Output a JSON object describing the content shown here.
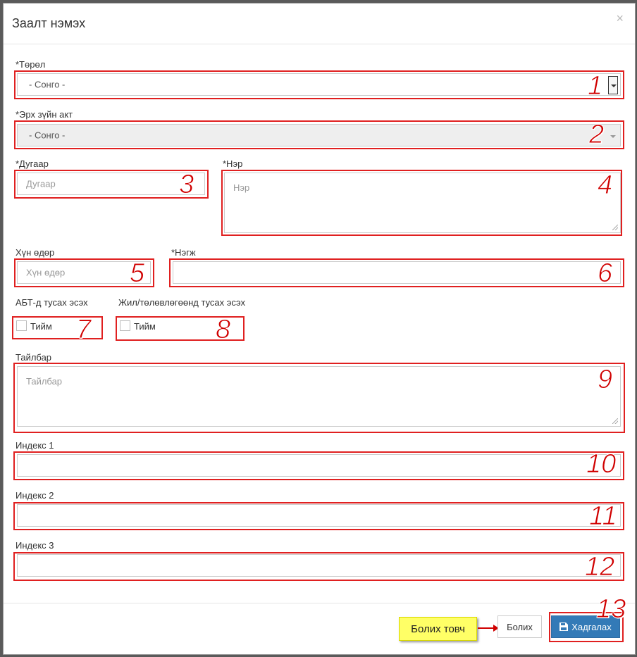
{
  "modal": {
    "title": "Заалт нэмэх",
    "close_label": "×"
  },
  "fields": {
    "torol": {
      "label": "*Төрөл",
      "value": "- Сонго -"
    },
    "erh_zuin_akt": {
      "label": "*Эрх зүйн акт",
      "value": "- Сонго -"
    },
    "dugaar": {
      "label": "*Дугаар",
      "placeholder": "Дугаар"
    },
    "ner": {
      "label": "*Нэр",
      "placeholder": "Нэр"
    },
    "hun_odor": {
      "label": "Хүн өдөр",
      "placeholder": "Хүн өдөр"
    },
    "negj": {
      "label": "*Нэгж",
      "value": ""
    },
    "abt": {
      "label": "АБТ-д тусах эсэх",
      "checkbox_label": "Тийм",
      "checked": false
    },
    "jil": {
      "label": "Жил/төлөвлөгөөнд тусах эсэх",
      "checkbox_label": "Тийм",
      "checked": false
    },
    "tailbar": {
      "label": "Тайлбар",
      "placeholder": "Тайлбар"
    },
    "index1": {
      "label": "Индекс 1",
      "value": ""
    },
    "index2": {
      "label": "Индекс 2",
      "value": ""
    },
    "index3": {
      "label": "Индекс 3",
      "value": ""
    }
  },
  "annotations": {
    "n1": "1",
    "n2": "2",
    "n3": "3",
    "n4": "4",
    "n5": "5",
    "n6": "6",
    "n7": "7",
    "n8": "8",
    "n9": "9",
    "n10": "10",
    "n11": "11",
    "n12": "12",
    "n13": "13",
    "callout": "Болих товч",
    "color": "#e02020"
  },
  "footer": {
    "cancel_label": "Болих",
    "save_label": "Хадгалах",
    "save_icon": "save-icon",
    "save_color": "#337ab7"
  }
}
